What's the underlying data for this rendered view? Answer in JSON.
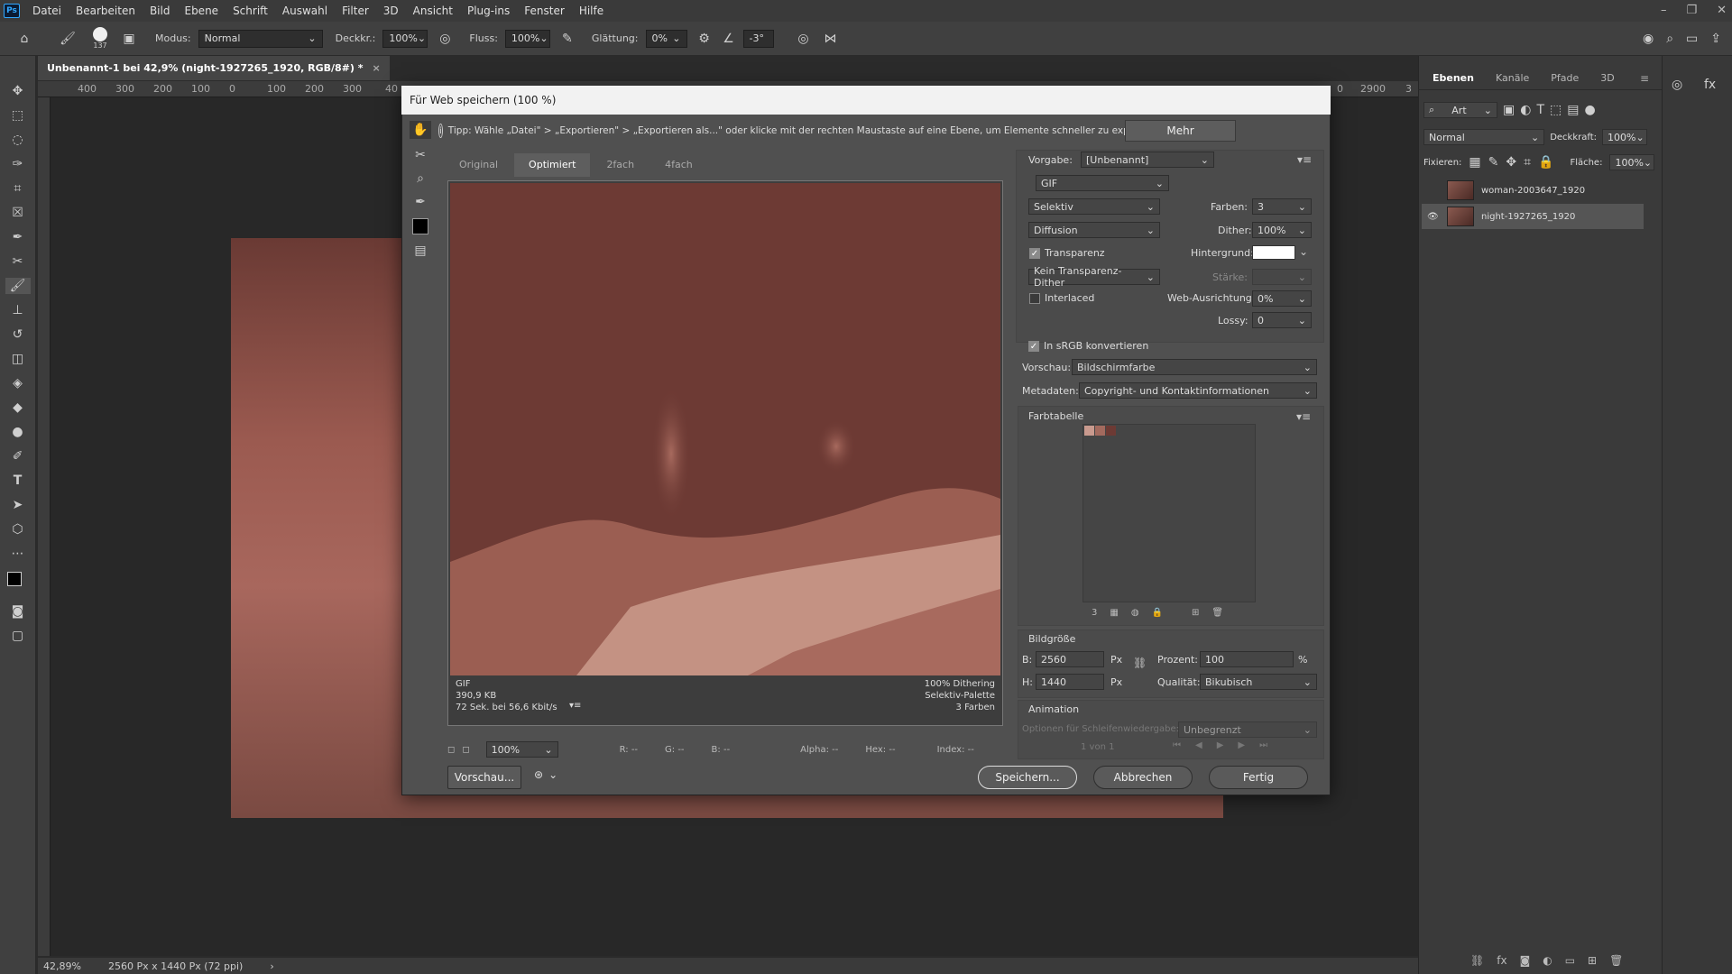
{
  "menubar": {
    "app_icon": "Ps",
    "items": [
      "Datei",
      "Bearbeiten",
      "Bild",
      "Ebene",
      "Schrift",
      "Auswahl",
      "Filter",
      "3D",
      "Ansicht",
      "Plug-ins",
      "Fenster",
      "Hilfe"
    ]
  },
  "optbar": {
    "brush_size": "137",
    "modus_label": "Modus:",
    "modus_value": "Normal",
    "deckkr_label": "Deckkr.:",
    "deckkr_value": "100%",
    "fluss_label": "Fluss:",
    "fluss_value": "100%",
    "glaettung_label": "Glättung:",
    "glaettung_value": "0%",
    "angle_value": "-3°"
  },
  "document": {
    "tab_title": "Unbenannt-1 bei 42,9% (night-1927265_1920, RGB/8#) *",
    "ruler_marks": [
      "400",
      "300",
      "200",
      "100",
      "0",
      "100",
      "200",
      "300",
      "40"
    ],
    "ruler_right": [
      "0",
      "2900",
      "3"
    ],
    "status_zoom": "42,89%",
    "status_size": "2560 Px x 1440 Px (72 ppi)"
  },
  "dialog": {
    "title": "Für Web speichern (100 %)",
    "tip": "Tipp: Wähle „Datei\" > „Exportieren\" > „Exportieren als...\" oder klicke mit der rechten Maustaste auf eine Ebene, um Elemente schneller zu exportieren",
    "mehr": "Mehr",
    "tabs": [
      "Original",
      "Optimiert",
      "2fach",
      "4fach"
    ],
    "preview_info": {
      "format": "GIF",
      "filesize": "390,9 KB",
      "speed": "72 Sek. bei 56,6 Kbit/s",
      "dithering": "100% Dithering",
      "palette": "Selektiv-Palette",
      "colors": "3 Farben"
    },
    "zoom": "100%",
    "readouts": {
      "r": "R: --",
      "g": "G: --",
      "b": "B: --",
      "alpha": "Alpha: --",
      "hex": "Hex: --",
      "index": "Index: --"
    },
    "buttons": {
      "vorschau": "Vorschau...",
      "speichern": "Speichern...",
      "abbrechen": "Abbrechen",
      "fertig": "Fertig"
    },
    "settings": {
      "vorgabe_label": "Vorgabe:",
      "vorgabe_value": "[Unbenannt]",
      "format": "GIF",
      "reduction": "Selektiv",
      "farben_label": "Farben:",
      "farben_value": "3",
      "dither_algo": "Diffusion",
      "dither_label": "Dither:",
      "dither_value": "100%",
      "transparenz_label": "Transparenz",
      "hintergrund_label": "Hintergrund:",
      "transparenz_dither": "Kein Transparenz-Dither",
      "staerke_label": "Stärke:",
      "interlaced_label": "Interlaced",
      "web_label": "Web-Ausrichtung:",
      "web_value": "0%",
      "lossy_label": "Lossy:",
      "lossy_value": "0",
      "srgb_label": "In sRGB konvertieren",
      "vorschau_label": "Vorschau:",
      "vorschau_value": "Bildschirmfarbe",
      "metadaten_label": "Metadaten:",
      "metadaten_value": "Copyright- und Kontaktinformationen",
      "farbtabelle_label": "Farbtabelle",
      "farbtabelle_count": "3",
      "swatches": [
        "#c99a8e",
        "#a36a5e",
        "#6d3a34"
      ],
      "bildgroesse_label": "Bildgröße",
      "b_label": "B:",
      "b_value": "2560",
      "h_label": "H:",
      "h_value": "1440",
      "px": "Px",
      "prozent_label": "Prozent:",
      "prozent_value": "100",
      "percent_sign": "%",
      "qualitaet_label": "Qualität:",
      "qualitaet_value": "Bikubisch",
      "animation_label": "Animation",
      "schleife_label": "Optionen für Schleifenwiedergabe:",
      "schleife_value": "Unbegrenzt",
      "frame_counter": "1 von 1"
    }
  },
  "layers_panel": {
    "tabs": [
      "Ebenen",
      "Kanäle",
      "Pfade",
      "3D"
    ],
    "filter_value": "Art",
    "blend_mode": "Normal",
    "deckkraft_label": "Deckkraft:",
    "deckkraft_value": "100%",
    "fixieren_label": "Fixieren:",
    "flaeche_label": "Fläche:",
    "flaeche_value": "100%",
    "layers": [
      {
        "name": "woman-2003647_1920",
        "visible": false
      },
      {
        "name": "night-1927265_1920",
        "visible": true
      }
    ]
  }
}
